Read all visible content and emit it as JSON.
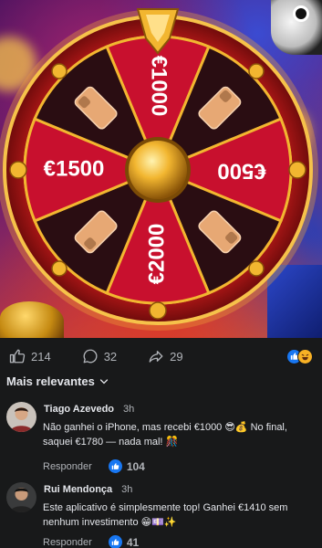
{
  "video": {
    "wheel_prizes": [
      "€1000",
      "€500",
      "€2000",
      "€1500"
    ],
    "colors": {
      "segment_red": "#c8102e",
      "segment_dark": "#2a0d12",
      "rim": "#b01a1a",
      "gold": "#f2b630"
    }
  },
  "reactions_bar": {
    "likes": "214",
    "comments": "32",
    "shares": "29",
    "icons": [
      "like-icon",
      "haha-icon"
    ]
  },
  "comments_section": {
    "sort_label": "Mais relevantes",
    "comments": [
      {
        "name": "Tiago Azevedo",
        "time": "3h",
        "text": "Não ganhei o iPhone, mas recebi €1000 😎💰 No final, saquei €1780 — nada mal! 🎊",
        "reply_label": "Responder",
        "likes": "104"
      },
      {
        "name": "Rui Mendonça",
        "time": "3h",
        "text": "Este aplicativo é simplesmente top! Ganhei €1410 sem nenhum investimento 😁💷✨",
        "reply_label": "Responder",
        "likes": "41"
      }
    ]
  }
}
